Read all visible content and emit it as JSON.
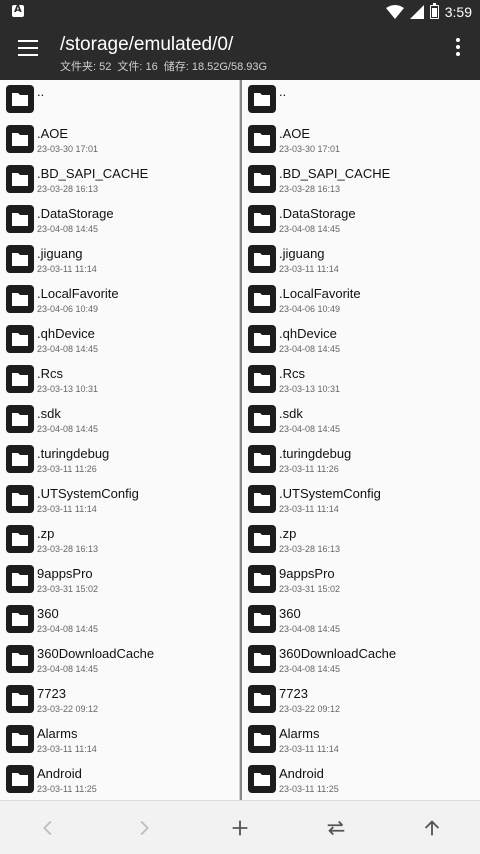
{
  "status": {
    "time": "3:59",
    "notification_glyph": "A"
  },
  "appbar": {
    "path": "/storage/emulated/0/",
    "folders_label": "文件夹: 52",
    "files_label": "文件: 16",
    "storage_label": "储存: 18.52G/58.93G"
  },
  "left_pane": {
    "items": [
      {
        "name": "..",
        "date": ""
      },
      {
        "name": ".AOE",
        "date": "23-03-30 17:01"
      },
      {
        "name": ".BD_SAPI_CACHE",
        "date": "23-03-28 16:13"
      },
      {
        "name": ".DataStorage",
        "date": "23-04-08 14:45"
      },
      {
        "name": ".jiguang",
        "date": "23-03-11 11:14"
      },
      {
        "name": ".LocalFavorite",
        "date": "23-04-06 10:49"
      },
      {
        "name": ".qhDevice",
        "date": "23-04-08 14:45"
      },
      {
        "name": ".Rcs",
        "date": "23-03-13 10:31"
      },
      {
        "name": ".sdk",
        "date": "23-04-08 14:45"
      },
      {
        "name": ".turingdebug",
        "date": "23-03-11 11:26"
      },
      {
        "name": ".UTSystemConfig",
        "date": "23-03-11 11:14"
      },
      {
        "name": ".zp",
        "date": "23-03-28 16:13"
      },
      {
        "name": "9appsPro",
        "date": "23-03-31 15:02"
      },
      {
        "name": "360",
        "date": "23-04-08 14:45"
      },
      {
        "name": "360DownloadCache",
        "date": "23-04-08 14:45"
      },
      {
        "name": "7723",
        "date": "23-03-22 09:12"
      },
      {
        "name": "Alarms",
        "date": "23-03-11 11:14"
      },
      {
        "name": "Android",
        "date": "23-03-11 11:25"
      }
    ]
  },
  "right_pane": {
    "items": [
      {
        "name": "..",
        "date": ""
      },
      {
        "name": ".AOE",
        "date": "23-03-30 17:01"
      },
      {
        "name": ".BD_SAPI_CACHE",
        "date": "23-03-28 16:13"
      },
      {
        "name": ".DataStorage",
        "date": "23-04-08 14:45"
      },
      {
        "name": ".jiguang",
        "date": "23-03-11 11:14"
      },
      {
        "name": ".LocalFavorite",
        "date": "23-04-06 10:49"
      },
      {
        "name": ".qhDevice",
        "date": "23-04-08 14:45"
      },
      {
        "name": ".Rcs",
        "date": "23-03-13 10:31"
      },
      {
        "name": ".sdk",
        "date": "23-04-08 14:45"
      },
      {
        "name": ".turingdebug",
        "date": "23-03-11 11:26"
      },
      {
        "name": ".UTSystemConfig",
        "date": "23-03-11 11:14"
      },
      {
        "name": ".zp",
        "date": "23-03-28 16:13"
      },
      {
        "name": "9appsPro",
        "date": "23-03-31 15:02"
      },
      {
        "name": "360",
        "date": "23-04-08 14:45"
      },
      {
        "name": "360DownloadCache",
        "date": "23-04-08 14:45"
      },
      {
        "name": "7723",
        "date": "23-03-22 09:12"
      },
      {
        "name": "Alarms",
        "date": "23-03-11 11:14"
      },
      {
        "name": "Android",
        "date": "23-03-11 11:25"
      }
    ]
  },
  "bottombar": {
    "icons": [
      "back-icon",
      "forward-icon",
      "add-icon",
      "swap-icon",
      "up-icon"
    ]
  },
  "colors": {
    "appbar": "#2b2b2b",
    "folder_icon": "#1d1d1d",
    "pane_bg": "#fafafa",
    "divider": "#8a8a8a",
    "disabled_icon": "#bdbdbd",
    "active_icon": "#555555"
  }
}
